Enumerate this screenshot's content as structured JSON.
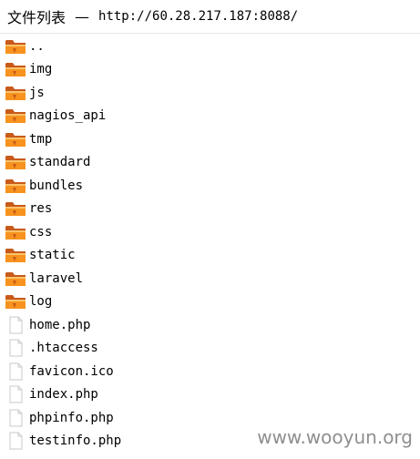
{
  "title": {
    "label": "文件列表",
    "separator": "—",
    "url": "http://60.28.217.187:8088/"
  },
  "entries": [
    {
      "name": "..",
      "type": "folder",
      "icon": "folder-icon"
    },
    {
      "name": "img",
      "type": "folder",
      "icon": "folder-icon"
    },
    {
      "name": "js",
      "type": "folder",
      "icon": "folder-icon"
    },
    {
      "name": "nagios_api",
      "type": "folder",
      "icon": "folder-icon"
    },
    {
      "name": "tmp",
      "type": "folder",
      "icon": "folder-icon"
    },
    {
      "name": "standard",
      "type": "folder",
      "icon": "folder-icon"
    },
    {
      "name": "bundles",
      "type": "folder",
      "icon": "folder-icon"
    },
    {
      "name": "res",
      "type": "folder",
      "icon": "folder-icon"
    },
    {
      "name": "css",
      "type": "folder",
      "icon": "folder-icon"
    },
    {
      "name": "static",
      "type": "folder",
      "icon": "folder-icon"
    },
    {
      "name": "laravel",
      "type": "folder",
      "icon": "folder-icon"
    },
    {
      "name": "log",
      "type": "folder",
      "icon": "folder-icon"
    },
    {
      "name": "home.php",
      "type": "file",
      "icon": "file-icon"
    },
    {
      "name": ".htaccess",
      "type": "file",
      "icon": "file-icon"
    },
    {
      "name": "favicon.ico",
      "type": "file",
      "icon": "file-icon"
    },
    {
      "name": "index.php",
      "type": "file",
      "icon": "file-icon"
    },
    {
      "name": "phpinfo.php",
      "type": "file",
      "icon": "file-icon"
    },
    {
      "name": "testinfo.php",
      "type": "file",
      "icon": "file-icon"
    }
  ],
  "watermark": "www.wooyun.org",
  "colors": {
    "folder_body": "#f7931e",
    "folder_dark": "#c85a1a",
    "folder_light": "#fbc36b",
    "file_outline": "#c8c8c8",
    "watermark": "#8f8f8f"
  }
}
